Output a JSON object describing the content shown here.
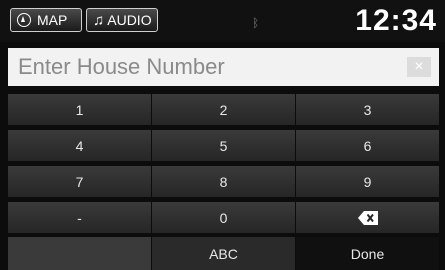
{
  "status": {
    "map_label": "MAP",
    "audio_label": "AUDIO",
    "time": "12:34",
    "icons": {
      "map": "map-compass-icon",
      "audio": "music-note-icon",
      "bluetooth": "bluetooth-icon"
    }
  },
  "entry": {
    "placeholder": "Enter House Number",
    "clear_label": "×"
  },
  "keypad": {
    "rows": [
      [
        "1",
        "2",
        "3"
      ],
      [
        "4",
        "5",
        "6"
      ],
      [
        "7",
        "8",
        "9"
      ],
      [
        "-",
        "0",
        ""
      ]
    ],
    "backspace_icon": "backspace-icon"
  },
  "bottom": {
    "abc_label": "ABC",
    "done_label": "Done"
  }
}
